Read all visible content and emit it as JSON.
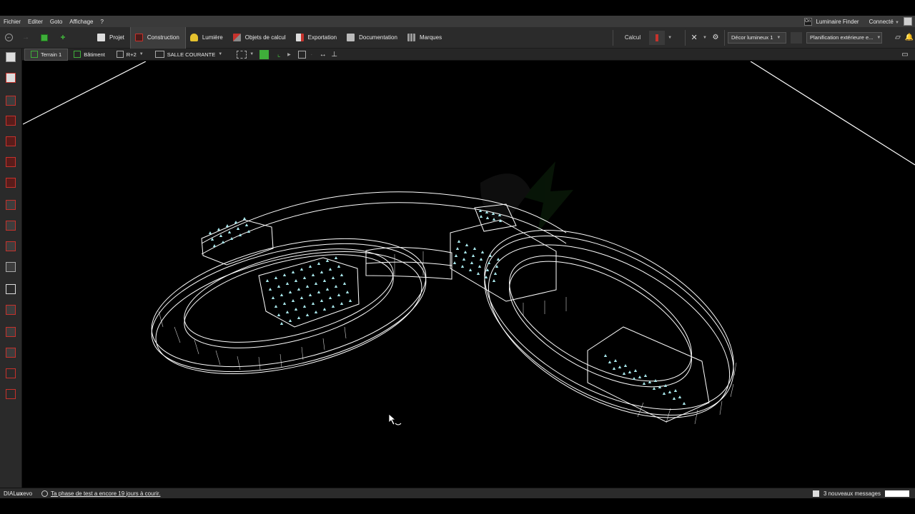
{
  "menu": {
    "items": [
      "Fichier",
      "Editer",
      "Goto",
      "Affichage",
      "?"
    ],
    "luminaire_finder": "Luminaire Finder",
    "connected": "Connecté"
  },
  "toolbar": {
    "tabs": [
      "Projet",
      "Construction",
      "Lumière",
      "Objets de calcul",
      "Exportation",
      "Documentation",
      "Marques"
    ],
    "active_tab": "Construction",
    "calc_label": "Calcul",
    "scene_dropdown": "Décor lumineux 1",
    "planning_dropdown": "Planification extérieure e..."
  },
  "subbar": {
    "terrain": "Terrain 1",
    "building": "Bâtiment",
    "level": "R+2",
    "room": "SALLE COURANTE"
  },
  "status": {
    "brand_light": "DIAL",
    "brand_bold": "ux",
    "brand_suffix": "evo",
    "trial_message": "Ta phase de test a encore 19 jours à courir.",
    "messages": "3 nouveaux messages"
  },
  "colors": {
    "accent_red": "#c6322c",
    "accent_green": "#3fae3a",
    "wireframe": "#ffffff",
    "luminaire": "#a8e6ea"
  }
}
